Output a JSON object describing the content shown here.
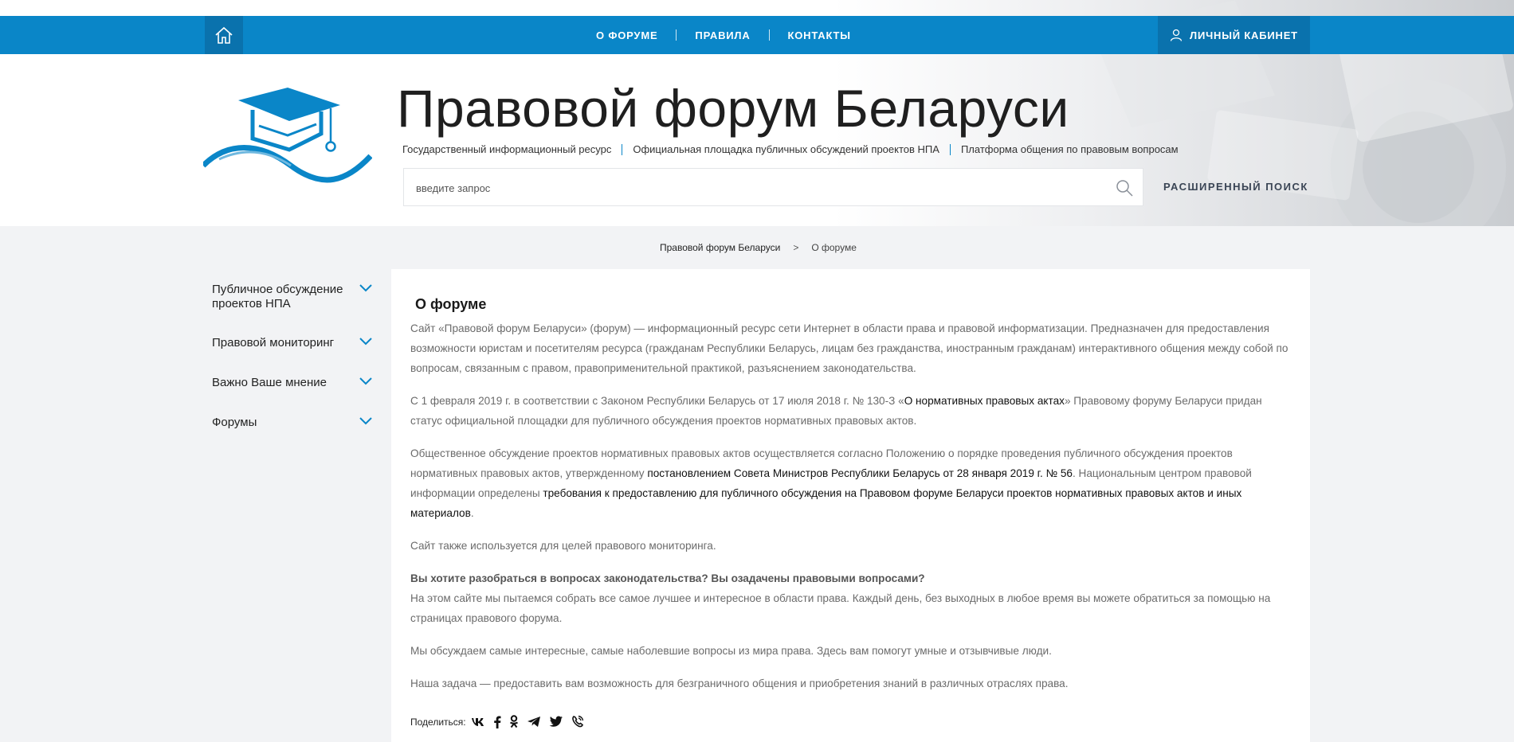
{
  "nav": {
    "links": [
      "О ФОРУМЕ",
      "ПРАВИЛА",
      "КОНТАКТЫ"
    ],
    "cabinet": "ЛИЧНЫЙ КАБИНЕТ"
  },
  "header": {
    "title": "Правовой форум Беларуси",
    "taglines": [
      "Государственный информационный ресурс",
      "Официальная площадка публичных обсуждений проектов НПА",
      "Платформа общения по правовым вопросам"
    ]
  },
  "search": {
    "placeholder": "введите запрос",
    "advanced": "РАСШИРЕННЫЙ ПОИСК"
  },
  "breadcrumb": {
    "home": "Правовой форум Беларуси",
    "separator": ">",
    "current": "О форуме"
  },
  "sidebar": {
    "items": [
      "Публичное обсуждение проектов НПА",
      "Правовой мониторинг",
      "Важно Ваше мнение",
      "Форумы"
    ]
  },
  "content": {
    "title": "О форуме",
    "p1": "Сайт «Правовой форум Беларуси» (форум) — информационный ресурс сети Интернет в области права и правовой информатизации. Предназначен для предоставления возможности юристам и посетителям ресурса (гражданам Республики Беларусь, лицам без гражданства, иностранным гражданам) интерактивного общения между собой по вопросам, связанным с правом, правоприменительной практикой, разъяснением законодательства.",
    "p2_before": "С 1 февраля 2019 г. в соответствии с Законом Республики Беларусь от 17 июля 2018 г. № 130-З «",
    "p2_link": "О нормативных правовых актах",
    "p2_after": "» Правовому форуму Беларуси придан статус официальной площадки для публичного обсуждения проектов нормативных правовых актов.",
    "p3_before": "Общественное обсуждение проектов нормативных правовых актов осуществляется согласно Положению о порядке проведения публичного обсуждения проектов нормативных правовых актов, утвержденному ",
    "p3_link1": "постановлением Совета Министров Республики Беларусь от 28 января 2019 г. № 56",
    "p3_middle": ". Национальным центром правовой информации определены ",
    "p3_link2": "требования к предоставлению для публичного обсуждения на Правовом форуме Беларуси проектов нормативных правовых актов и иных материалов",
    "p3_after": ".",
    "p4": "Сайт также используется для целей правового мониторинга.",
    "p5_bold": "Вы хотите разобраться в вопросах законодательства? Вы озадачены правовыми вопросами?",
    "p5": "На этом сайте мы пытаемся собрать все самое лучшее и интересное в области права. Каждый день, без выходных в любое время вы можете обратиться за помощью на страницах правового форума.",
    "p6": "Мы обсуждаем самые интересные, самые наболевшие вопросы из мира права. Здесь вам помогут умные и отзывчивые люди.",
    "p7": "Наша задача — предоставить вам возможность для безграничного общения и приобретения знаний в различных отраслях права.",
    "share_label": "Поделиться:",
    "share_icons": [
      "vk-icon",
      "facebook-icon",
      "odnoklassniki-icon",
      "telegram-icon",
      "twitter-icon",
      "viber-icon"
    ]
  },
  "colors": {
    "brand_blue": "#0a86c8",
    "brand_dark": "#0a72ad",
    "page_bg": "#f2f3f5"
  }
}
